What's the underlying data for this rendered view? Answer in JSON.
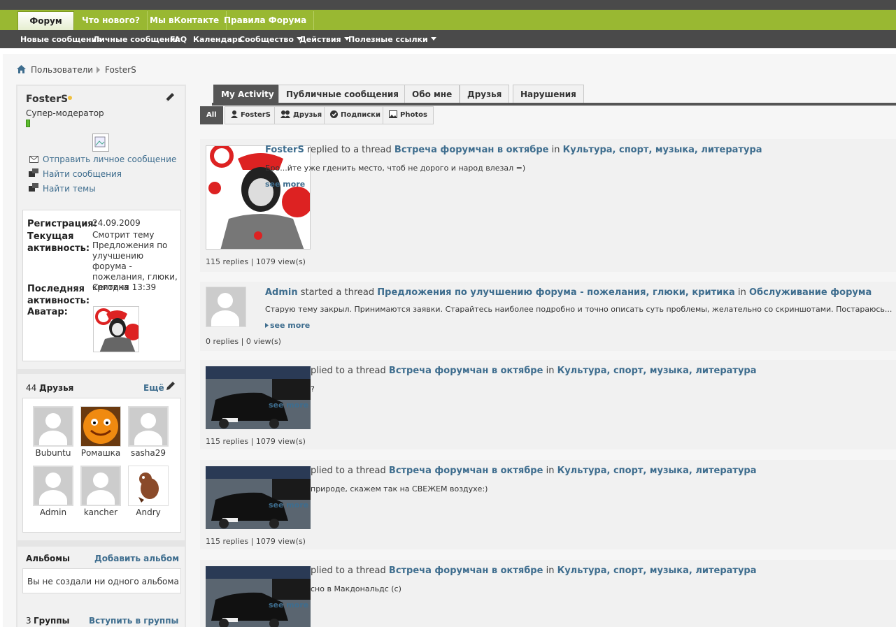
{
  "nav": {
    "tabs": [
      "Форум",
      "Что нового?",
      "Мы вКонтакте",
      "Правила Форума"
    ],
    "sub": [
      "Новые сообщения",
      "Личные сообщения",
      "FAQ",
      "Календарь",
      "Сообщество",
      "Действия",
      "Полезные ссылки"
    ]
  },
  "breadcrumb": {
    "root": "Пользователи",
    "current": "FosterS"
  },
  "profile": {
    "username": "FosterS",
    "title": "Супер-модератор",
    "links": [
      "Отправить личное сообщение",
      "Найти сообщения",
      "Найти темы"
    ],
    "registration_label": "Регистрация:",
    "registration_value": "24.09.2009",
    "current_activity_label": "Текущая активность:",
    "current_activity_value": "Смотрит тему Предложения по улучшению форума - пожелания, глюки, критика",
    "last_activity_label": "Последняя активность:",
    "last_activity_value": "Сегодня 13:39",
    "avatar_label": "Аватар:"
  },
  "friends": {
    "count": "44",
    "title": "Друзья",
    "more": "Ещё",
    "list": [
      "Bubuntu",
      "Ромашка",
      "sasha29",
      "Admin",
      "kancher",
      "Andry"
    ]
  },
  "albums": {
    "title": "Альбомы",
    "add": "Добавить альбом",
    "empty": "Вы не создали ни одного альбома"
  },
  "groups": {
    "count": "3",
    "title": "Группы",
    "join": "Вступить в группы"
  },
  "main_tabs": [
    "My Activity",
    "Публичные сообщения",
    "Обо мне",
    "Друзья",
    "Нарушения"
  ],
  "sub_tabs": [
    "All",
    "FosterS",
    "Друзья",
    "Подписки",
    "Photos"
  ],
  "activity": [
    {
      "user": "FosterS",
      "action": "replied to a thread",
      "thread": "Встреча форумчан в октябре",
      "in": "in",
      "forum": "Культура, спорт, музыка, литература",
      "excerpt": "Бро...йте уже гденить место, чтоб не дорого и народ влезал =)",
      "more": "see more",
      "stats": "115 replies | 1079 view(s)"
    },
    {
      "user": "Admin",
      "action": "started a thread",
      "thread": "Предложения по улучшению форума - пожелания, глюки, критика",
      "in": "in",
      "forum": "Обслуживание форума",
      "excerpt": "Старую тему закрыл. Принимаются заявки. Старайтесь наиболее подробно и точно описать суть проблемы, желательно со скриншотами. Постараюсь...",
      "more": "see more",
      "stats": "0 replies | 0 view(s)"
    },
    {
      "user": "",
      "action": "plied to a thread",
      "thread": "Встреча форумчан в октябре",
      "in": "in",
      "forum": "Культура, спорт, музыка, литература",
      "excerpt": "?",
      "more": "see more",
      "stats": "115 replies | 1079 view(s)"
    },
    {
      "user": "",
      "action": "plied to a thread",
      "thread": "Встреча форумчан в октябре",
      "in": "in",
      "forum": "Культура, спорт, музыка, литература",
      "excerpt": "природе, скажем так на СВЕЖЕМ воздухе:)",
      "more": "see more",
      "stats": "115 replies | 1079 view(s)"
    },
    {
      "user": "",
      "action": "plied to a thread",
      "thread": "Встреча форумчан в октябре",
      "in": "in",
      "forum": "Культура, спорт, музыка, литература",
      "excerpt": "сно в Макдональдс (с)",
      "more": "see more",
      "stats": ""
    }
  ],
  "colors": {
    "nav_green": "#99b832",
    "dark": "#4a4a4a",
    "link": "#3e6d8e"
  }
}
